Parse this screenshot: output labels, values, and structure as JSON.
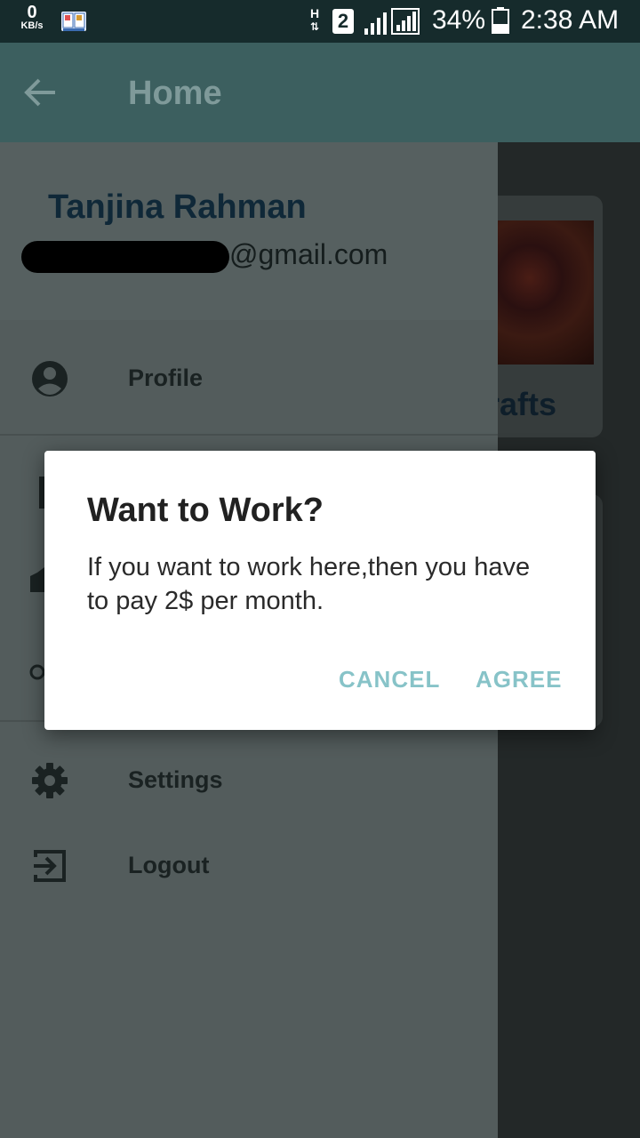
{
  "status_bar": {
    "speed_value": "0",
    "speed_unit": "KB/s",
    "network_type": "H",
    "sim_slot": "2",
    "battery_percent": "34%",
    "time": "2:38 AM"
  },
  "app_bar": {
    "title": "Home",
    "back_icon": "arrow-back-icon"
  },
  "background_content": {
    "card_title_partial": "rafts"
  },
  "drawer": {
    "user_name": "Tanjina Rahman",
    "email_visible": "@gmail.com",
    "items": [
      {
        "label": "Profile",
        "icon": "account-circle-icon"
      },
      {
        "label": "Settings",
        "icon": "gear-icon"
      },
      {
        "label": "Logout",
        "icon": "logout-icon"
      }
    ]
  },
  "dialog": {
    "title": "Want to Work?",
    "message": "If you want to work here,then you have to pay 2$ per month.",
    "cancel_label": "CANCEL",
    "agree_label": "AGREE"
  },
  "colors": {
    "status_bar": "#162b2c",
    "app_bar": "#3c5f5f",
    "drawer": "#535c5c",
    "accent": "#87c3c8",
    "user_name": "#0f2838"
  }
}
